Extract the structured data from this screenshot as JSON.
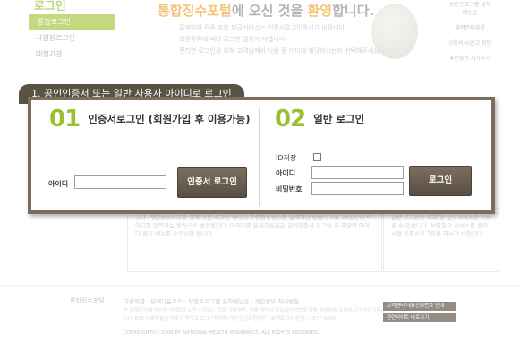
{
  "background": {
    "sidebar_title": "로그인",
    "sidebar_items": [
      "통합로그인",
      "사업장로그인",
      "대행기관"
    ],
    "headline_part1": "통합징수포털",
    "headline_part2": "에 오신 것을 ",
    "headline_part3": "환영",
    "headline_part4": "합니다.",
    "desc_lines": [
      "홈페이지 각종 조회 발급서비스는 인증서로그인하시기 바랍니다.",
      "회원종류에 따라 로그인 절차가 다릅니다.",
      "편리한 로그인을 위해 고객님께서 다음 중 어디에 해당하시는지 선택해주세요."
    ],
    "side_items": [
      "보안프로그램 설치매뉴얼",
      "출력문제해결",
      "공통서식/신고 확인",
      "#큰화면 지시하기"
    ],
    "lower_left_text": "니다.\n개인정보보호를 위해 기존 로그인 아이디 주민등록번호를 입력하던 방법이 9월 23일부터 아이디를 입력하는 방식으로 변경됩니다. 아이디를 분실하신분은 공인인증서 로그인 후 해당의 아이디 찾기 메뉴를 누르시면 됩니다.",
    "lower_right_text": "일반 로그인은 조회 및 일부서비스만 이용할 수 있습니다.\n보안필요 서비스를 원하시면 인증서로그인을 하시기 바랍니다.",
    "footer_logo": "통합징수포털",
    "footer_links": "이용약관 · 뷰어다운로드 · 보안프로그램 설치매뉴얼 · 개인정보 처리방침",
    "footer_addr_lines": [
      "본 홈페이지에 게시된 이메일주소가 수집되는 것을 거부하며, 이를 위반시 정보통신망법에 의해 처벌됨을 유념하시기 바랍니다.",
      "121-876 서울특별시 마포구 독막로 311 (염리동) 국민건강보험공단 | 보험료징수 문의 : 1577-1000"
    ],
    "footer_copy": "COPYRIGHT(C) 2009 BY NATIONAL HEALTH INSURANCE. ALL RIGHTS RESERVED.",
    "footer_btn1": "고객센터 대표전화번호 안내",
    "footer_btn2": "관련사이트 바로가기"
  },
  "popup": {
    "tab_label": "1. 공인인증서 또는 일반 사용자 아이디로 로그인",
    "section1": {
      "number": "01",
      "title": "인증서로그인 (회원가입 후 이용가능)",
      "id_label": "아이디",
      "id_value": "",
      "button": "인증서 로그인"
    },
    "section2": {
      "number": "02",
      "title": "일반 로그인",
      "save_id_label": "ID저장",
      "id_label": "아이디",
      "id_value": "",
      "pw_label": "비밀번호",
      "pw_value": "",
      "button": "로그인"
    }
  },
  "colors": {
    "accent_green": "#9bbf2e",
    "brown": "#5b5246",
    "headline_orange": "#f2a32d"
  }
}
